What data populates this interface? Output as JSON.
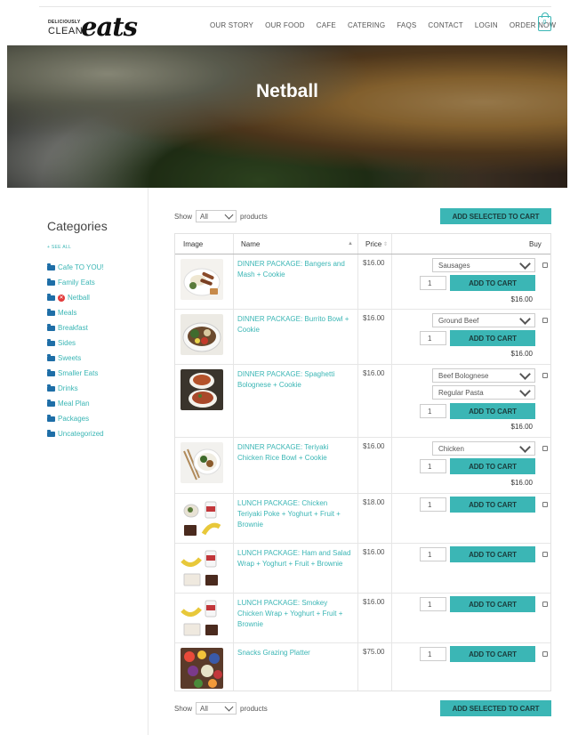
{
  "header": {
    "logo_small1": "DELICIOUSLY",
    "logo_small2": "CLEAN",
    "logo_script": "eats",
    "nav": [
      "OUR STORY",
      "OUR FOOD",
      "CAFE",
      "CATERING",
      "FAQS",
      "CONTACT",
      "LOGIN",
      "ORDER NOW"
    ],
    "cart_count": "0",
    "accent": "#3bb6b5"
  },
  "hero": {
    "title": "Netball"
  },
  "sidebar": {
    "title": "Categories",
    "see_all": "+ SEE ALL",
    "items": [
      {
        "label": "Cafe TO YOU!"
      },
      {
        "label": "Family Eats"
      },
      {
        "label": "Netball"
      },
      {
        "label": "Meals"
      },
      {
        "label": "Breakfast"
      },
      {
        "label": "Sides"
      },
      {
        "label": "Sweets"
      },
      {
        "label": "Smaller Eats"
      },
      {
        "label": "Drinks"
      },
      {
        "label": "Meal Plan"
      },
      {
        "label": "Packages"
      },
      {
        "label": "Uncategorized"
      }
    ]
  },
  "controls": {
    "show_label": "Show",
    "show_value": "All",
    "products_label": "products",
    "add_selected": "ADD SELECTED TO CART"
  },
  "table": {
    "headers": {
      "image": "Image",
      "name": "Name",
      "price": "Price",
      "buy": "Buy"
    },
    "add_label": "ADD TO CART",
    "rows": [
      {
        "name": "DINNER PACKAGE: Bangers and Mash + Cookie",
        "price": "$16.00",
        "options": [
          "Sausages"
        ],
        "qty": "1",
        "subtotal": "$16.00"
      },
      {
        "name": "DINNER PACKAGE: Burrito Bowl + Cookie",
        "price": "$16.00",
        "options": [
          "Ground Beef"
        ],
        "qty": "1",
        "subtotal": "$16.00"
      },
      {
        "name": "DINNER PACKAGE: Spaghetti Bolognese + Cookie",
        "price": "$16.00",
        "options": [
          "Beef Bolognese",
          "Regular Pasta"
        ],
        "qty": "1",
        "subtotal": "$16.00"
      },
      {
        "name": "DINNER PACKAGE: Teriyaki Chicken Rice Bowl + Cookie",
        "price": "$16.00",
        "options": [
          "Chicken"
        ],
        "qty": "1",
        "subtotal": "$16.00"
      },
      {
        "name": "LUNCH PACKAGE: Chicken Teriyaki Poke + Yoghurt + Fruit + Brownie",
        "price": "$18.00",
        "options": [],
        "qty": "1",
        "subtotal": ""
      },
      {
        "name": "LUNCH PACKAGE: Ham and Salad Wrap + Yoghurt + Fruit + Brownie",
        "price": "$16.00",
        "options": [],
        "qty": "1",
        "subtotal": ""
      },
      {
        "name": "LUNCH PACKAGE: Smokey Chicken Wrap + Yoghurt + Fruit + Brownie",
        "price": "$16.00",
        "options": [],
        "qty": "1",
        "subtotal": ""
      },
      {
        "name": "Snacks Grazing Platter",
        "price": "$75.00",
        "options": [],
        "qty": "1",
        "subtotal": ""
      }
    ]
  }
}
